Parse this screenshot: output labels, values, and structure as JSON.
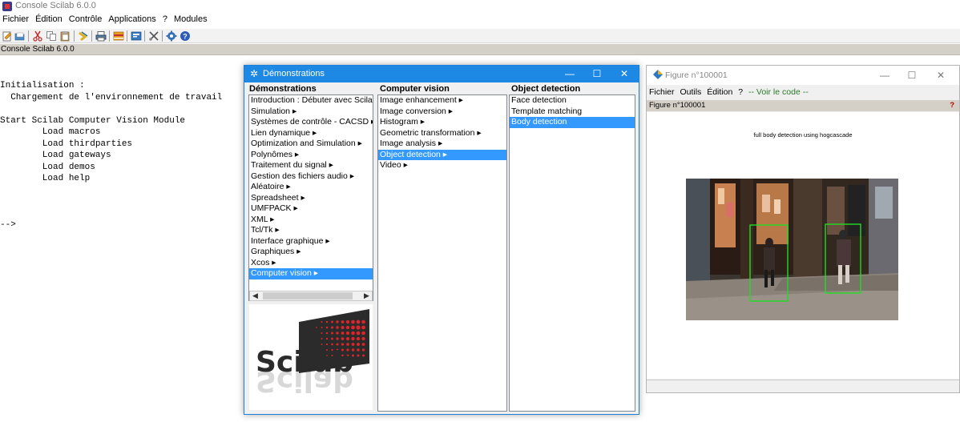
{
  "console": {
    "title": "Console Scilab 6.0.0",
    "menu": [
      "Fichier",
      "Édition",
      "Contrôle",
      "Applications",
      "?",
      "Modules"
    ],
    "tab_label": "Console Scilab 6.0.0",
    "lines": [
      "Initialisation :",
      "  Chargement de l'environnement de travail",
      "",
      "Start Scilab Computer Vision Module",
      "        Load macros",
      "        Load thirdparties",
      "        Load gateways",
      "        Load demos",
      "        Load help",
      "",
      "",
      "",
      "-->"
    ],
    "toolbar_icons": [
      "new-script-icon",
      "open-icon",
      "cut-icon",
      "copy-icon",
      "paste-icon",
      "change-directory-icon",
      "print-icon",
      "variable-browser-icon",
      "scinotes-icon",
      "xcos-icon",
      "module-manager-icon",
      "help-icon"
    ]
  },
  "demo": {
    "title": "Démonstrations",
    "col1_header": "Démonstrations",
    "col2_header": "Computer vision",
    "col3_header": "Object detection",
    "col1_items": [
      "Introduction : Débuter avec Scilab",
      "Simulation ▸",
      "Systèmes de contrôle - CACSD ▸",
      "Lien dynamique ▸",
      "Optimization and Simulation ▸",
      "Polynômes ▸",
      "Traitement du signal ▸",
      "Gestion des fichiers audio ▸",
      "Aléatoire ▸",
      "Spreadsheet ▸",
      "UMFPACK ▸",
      "XML ▸",
      "Tcl/Tk ▸",
      "Interface graphique ▸",
      "Graphiques ▸",
      "Xcos ▸",
      "Computer vision ▸"
    ],
    "col1_selected": 16,
    "col2_items": [
      "Image enhancement ▸",
      "Image conversion ▸",
      "Histogram ▸",
      "Geometric transformation ▸",
      "Image analysis ▸",
      "Object detection ▸",
      "Video ▸"
    ],
    "col2_selected": 5,
    "col3_items": [
      "Face detection",
      "Template matching",
      "Body detection"
    ],
    "col3_selected": 2
  },
  "figure": {
    "title": "Figure n°100001",
    "menu": [
      "Fichier",
      "Outils",
      "Édition",
      "?"
    ],
    "code_link": "-- Voir le code --",
    "tab_label": "Figure n°100001",
    "tab_help": "?",
    "plot_title": "full body detection using hogcascade"
  },
  "colors": {
    "demo_title_bg": "#1e88e5",
    "selection": "#3399ff",
    "detection_box": "#22dd22"
  }
}
